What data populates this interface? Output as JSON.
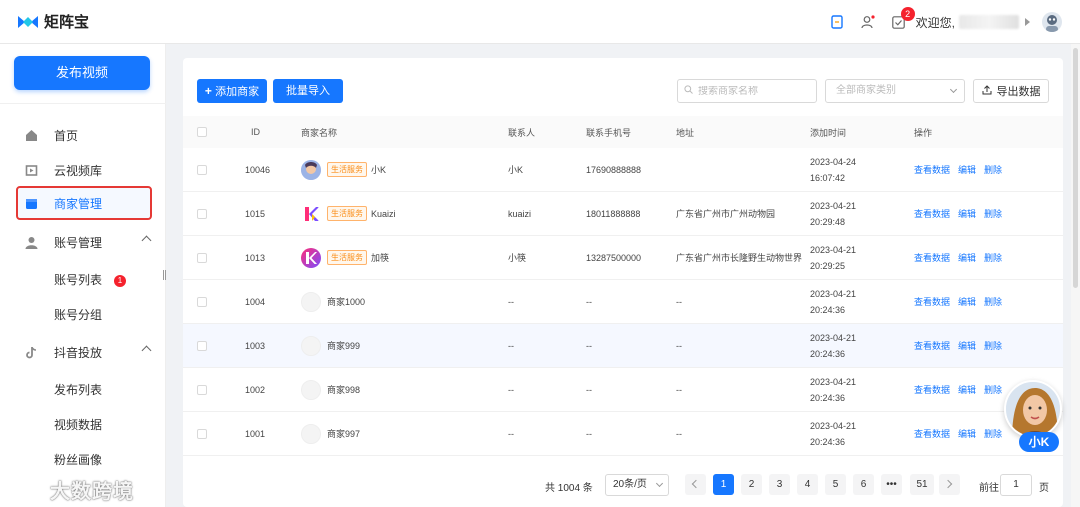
{
  "app": {
    "name": "矩阵宝"
  },
  "topbar": {
    "notification_count": "2",
    "welcome": "欢迎您,"
  },
  "sidebar": {
    "publish_label": "发布视频",
    "items": [
      {
        "label": "首页",
        "icon": "home-icon"
      },
      {
        "label": "云视频库",
        "icon": "video-library-icon"
      },
      {
        "label": "商家管理",
        "icon": "store-icon",
        "active": true
      },
      {
        "label": "账号管理",
        "icon": "user-icon",
        "expanded": true
      },
      {
        "label": "抖音投放",
        "icon": "tiktok-icon",
        "expanded": true
      }
    ],
    "account_sub": [
      {
        "label": "账号列表",
        "badge": "1"
      },
      {
        "label": "账号分组"
      }
    ],
    "douyin_sub": [
      {
        "label": "发布列表"
      },
      {
        "label": "视频数据"
      },
      {
        "label": "粉丝画像"
      }
    ],
    "watermark": "大数跨境"
  },
  "toolbar": {
    "add_label": "添加商家",
    "import_label": "批量导入",
    "search_placeholder": "搜索商家名称",
    "category_placeholder": "全部商家类别",
    "export_label": "导出数据"
  },
  "table": {
    "headers": [
      "ID",
      "商家名称",
      "联系人",
      "联系手机号",
      "地址",
      "添加时间",
      "操作"
    ],
    "actions": [
      "查看数据",
      "编辑",
      "删除"
    ],
    "rows": [
      {
        "id": "10046",
        "tag": "生活服务",
        "name": "小K",
        "contact": "小K",
        "phone": "17690888888",
        "address": "",
        "date": "2023-04-24",
        "time": "16:07:42",
        "avatar": "photo"
      },
      {
        "id": "1015",
        "tag": "生活服务",
        "name": "Kuaizi",
        "contact": "kuaizi",
        "phone": "18011888888",
        "address": "广东省广州市广州动物园",
        "date": "2023-04-21",
        "time": "20:29:48",
        "avatar": "k-logo"
      },
      {
        "id": "1013",
        "tag": "生活服务",
        "name": "加筷",
        "contact": "小筷",
        "phone": "13287500000",
        "address": "广东省广州市长隆野生动物世界",
        "date": "2023-04-21",
        "time": "20:29:25",
        "avatar": "k-circle"
      },
      {
        "id": "1004",
        "tag": "",
        "name": "商家1000",
        "contact": "--",
        "phone": "--",
        "address": "--",
        "date": "2023-04-21",
        "time": "20:24:36",
        "avatar": "placeholder"
      },
      {
        "id": "1003",
        "tag": "",
        "name": "商家999",
        "contact": "--",
        "phone": "--",
        "address": "--",
        "date": "2023-04-21",
        "time": "20:24:36",
        "avatar": "placeholder"
      },
      {
        "id": "1002",
        "tag": "",
        "name": "商家998",
        "contact": "--",
        "phone": "--",
        "address": "--",
        "date": "2023-04-21",
        "time": "20:24:36",
        "avatar": "placeholder"
      },
      {
        "id": "1001",
        "tag": "",
        "name": "商家997",
        "contact": "--",
        "phone": "--",
        "address": "--",
        "date": "2023-04-21",
        "time": "20:24:36",
        "avatar": "placeholder"
      }
    ]
  },
  "pagination": {
    "total": "共 1004 条",
    "page_size": "20条/页",
    "pages": [
      "1",
      "2",
      "3",
      "4",
      "5",
      "6",
      "•••",
      "51"
    ],
    "current": "1",
    "goto_label": "前往",
    "goto_value": "1",
    "page_suffix": "页"
  },
  "assistant": {
    "label": "小K"
  },
  "colors": {
    "primary": "#1677ff",
    "danger": "#f5222d",
    "tag": "#fa8c16",
    "highlight": "#e53935"
  }
}
